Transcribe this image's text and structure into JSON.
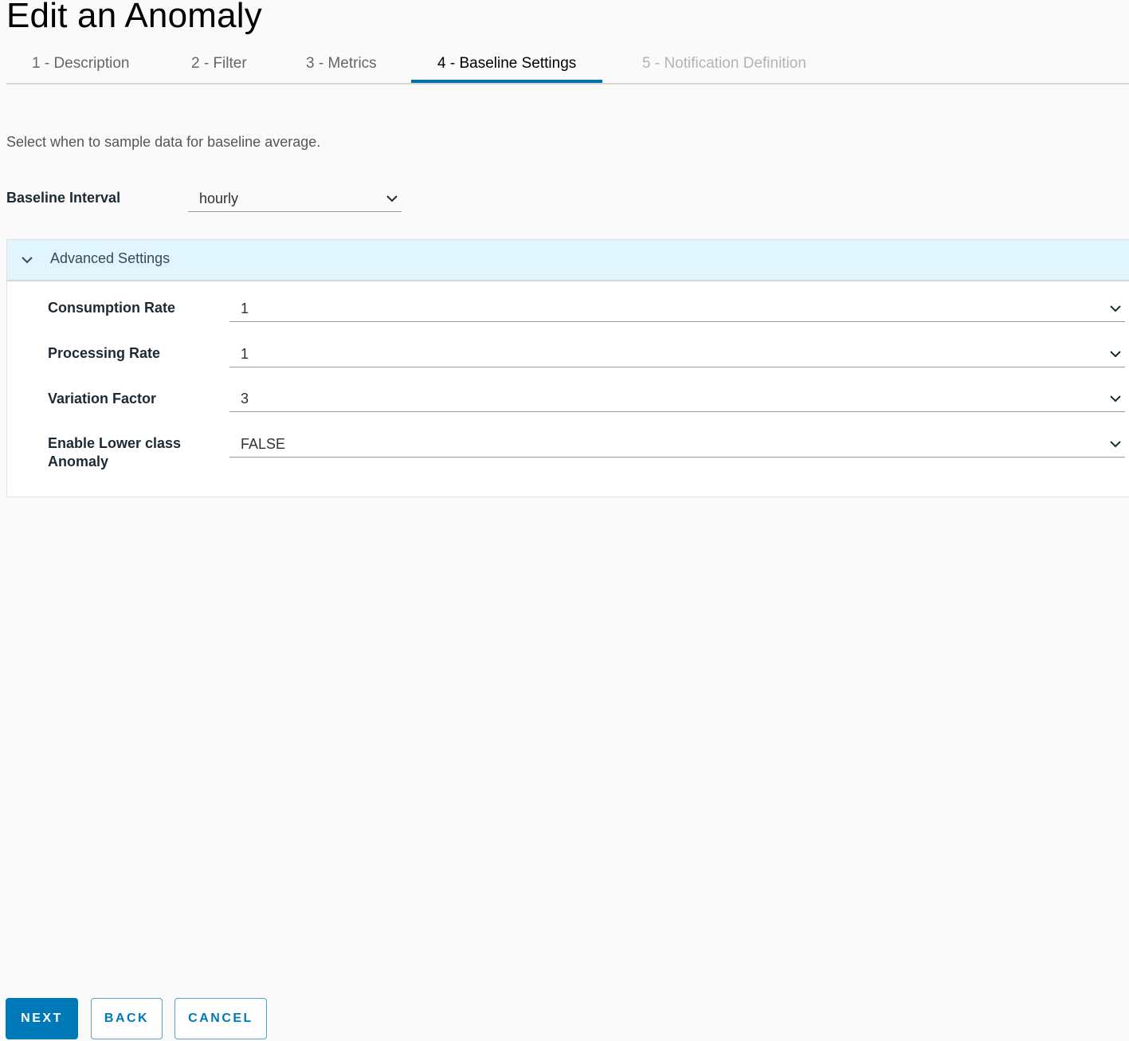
{
  "page": {
    "title": "Edit an Anomaly"
  },
  "wizard": {
    "tabs": [
      {
        "label": "1 - Description",
        "state": "completed"
      },
      {
        "label": "2 - Filter",
        "state": "completed"
      },
      {
        "label": "3 - Metrics",
        "state": "completed"
      },
      {
        "label": "4 - Baseline Settings",
        "state": "active"
      },
      {
        "label": "5 - Notification Definition",
        "state": "disabled"
      }
    ]
  },
  "baseline": {
    "instruction": "Select when to sample data for baseline average.",
    "interval_label": "Baseline Interval",
    "interval_value": "hourly"
  },
  "advanced": {
    "header_label": "Advanced Settings",
    "expanded": true,
    "fields": [
      {
        "label": "Consumption Rate",
        "value": "1"
      },
      {
        "label": "Processing Rate",
        "value": "1"
      },
      {
        "label": "Variation Factor",
        "value": "3"
      },
      {
        "label": "Enable Lower class Anomaly",
        "value": "FALSE"
      }
    ]
  },
  "footer": {
    "next_label": "NEXT",
    "back_label": "BACK",
    "cancel_label": "CANCEL"
  },
  "colors": {
    "accent": "#0079b8",
    "active_tab_underline": "#0072a3",
    "panel_header_bg": "#e1f5fd"
  }
}
